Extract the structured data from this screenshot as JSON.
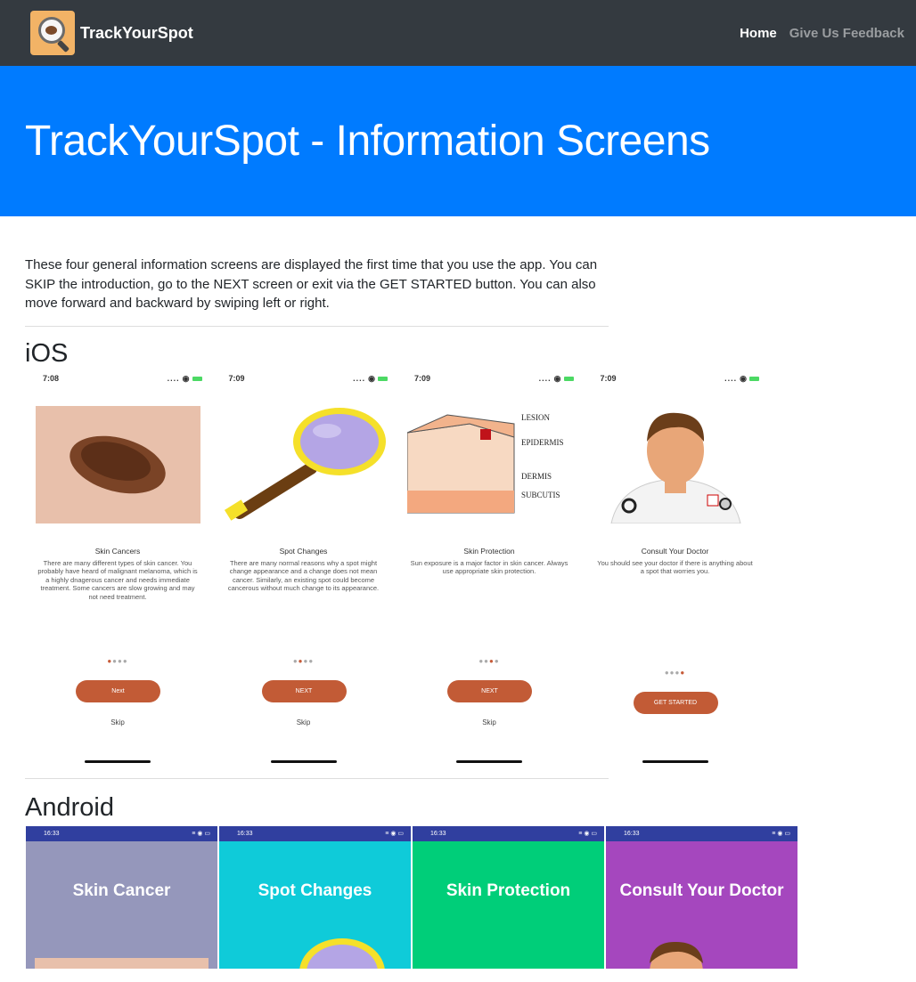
{
  "navbar": {
    "brand": "TrackYourSpot",
    "links": {
      "home": "Home",
      "feedback": "Give Us Feedback"
    }
  },
  "hero": {
    "title": "TrackYourSpot - Information Screens"
  },
  "intro": "These four general information screens are displayed the first time that you use the app. You can SKIP the introduction, go to the NEXT screen or exit via the GET STARTED button. You can also move forward and backward by swiping left or right.",
  "ios": {
    "heading": "iOS",
    "screens": [
      {
        "time": "7:08",
        "title": "Skin Cancers",
        "body": "There are many different types of skin cancer. You probably have heard of malignant melanoma, which is a highly dnagerous cancer and needs immediate treatment. Some cancers are slow growing and may not need treatment.",
        "button": "Next",
        "skip": "Skip",
        "page": 1
      },
      {
        "time": "7:09",
        "title": "Spot Changes",
        "body": "There are many normal reasons why a spot might change appearance and a change does not mean cancer. Similarly, an existing spot could become cancerous without much change to its appearance.",
        "button": "NEXT",
        "skip": "Skip",
        "page": 2
      },
      {
        "time": "7:09",
        "title": "Skin Protection",
        "body": "Sun exposure is a major factor in skin cancer. Always use appropriate skin protection.",
        "button": "NEXT",
        "skip": "Skip",
        "page": 3
      },
      {
        "time": "7:09",
        "title": "Consult Your Doctor",
        "body": "You should see your doctor if there is anything about a spot that worries you.",
        "button": "GET STARTED",
        "skip": "",
        "page": 4
      }
    ],
    "skin_labels": {
      "lesion": "LESION",
      "epidermis": "EPIDERMIS",
      "dermis": "DERMIS",
      "subcutis": "SUBCUTIS"
    }
  },
  "android": {
    "heading": "Android",
    "screens": [
      {
        "time": "16:33",
        "title": "Skin Cancer",
        "bg": "#9597bb"
      },
      {
        "time": "16:33",
        "title": "Spot Changes",
        "bg": "#0fcbd9"
      },
      {
        "time": "16:33",
        "title": "Skin Protection",
        "bg": "#00ce79"
      },
      {
        "time": "16:33",
        "title": "Consult Your Doctor",
        "bg": "#a547be"
      }
    ]
  },
  "colors": {
    "navbar": "#343a40",
    "hero": "#007bff",
    "button": "#c25b36"
  }
}
